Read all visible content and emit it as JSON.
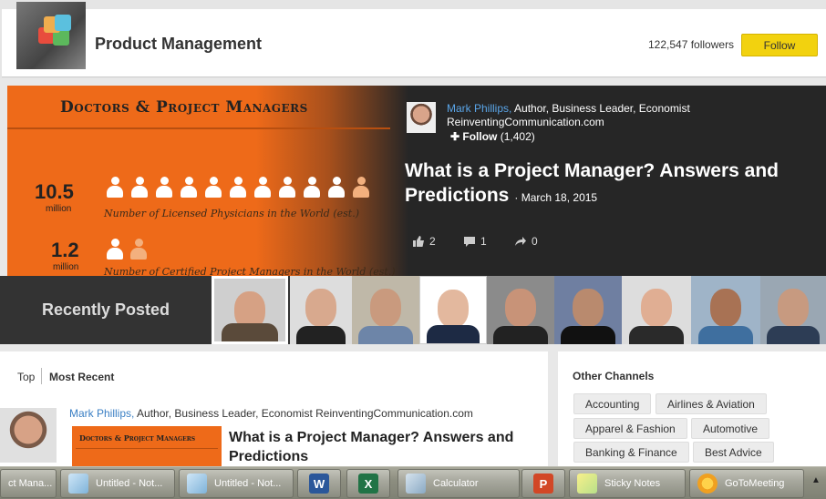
{
  "channel": {
    "title": "Product Management",
    "followers": "122,547 followers",
    "follow_label": "Follow"
  },
  "hero": {
    "infographic": {
      "title": "Doctors & Project Managers",
      "stat1_value": "10.5",
      "stat1_unit": "million",
      "stat1_desc": "Number of Licensed Physicians in the World (est.)",
      "stat2_value": "1.2",
      "stat2_unit": "million",
      "stat2_desc": "Number of Certified Project Managers in the World (est.)"
    },
    "author_name": "Mark Phillips,",
    "author_role": " Author, Business Leader, Economist",
    "author_site": "ReinventingCommunication.com",
    "follow_label": "✚ Follow",
    "follow_count": "(1,402)",
    "article_title": "What is a Project Manager? Answers and Predictions",
    "article_date": "· March 18, 2015",
    "likes": "2",
    "comments": "1",
    "shares": "0"
  },
  "recent": {
    "label": "Recently Posted"
  },
  "feed": {
    "tab_top": "Top",
    "tab_recent": "Most Recent",
    "author_name": "Mark Phillips,",
    "author_rest": " Author, Business Leader, Economist ReinventingCommunication.com",
    "thumb_title": "Doctors & Project Managers",
    "title": "What is a Project Manager? Answers and Predictions"
  },
  "channels": {
    "title": "Other Channels",
    "items": [
      "Accounting",
      "Airlines & Aviation",
      "Apparel & Fashion",
      "Automotive",
      "Banking & Finance",
      "Best Advice"
    ]
  },
  "taskbar": {
    "items": [
      {
        "label": "ct Mana...",
        "icon": "browser-icon"
      },
      {
        "label": "Untitled - Not...",
        "icon": "notepad-icon"
      },
      {
        "label": "Untitled - Not...",
        "icon": "notepad-icon"
      },
      {
        "label": "",
        "icon": "word-icon"
      },
      {
        "label": "",
        "icon": "excel-icon"
      },
      {
        "label": "Calculator",
        "icon": "calculator-icon"
      },
      {
        "label": "",
        "icon": "powerpoint-icon"
      },
      {
        "label": "Sticky Notes",
        "icon": "sticky-notes-icon"
      },
      {
        "label": "GoToMeeting",
        "icon": "gotomeeting-icon"
      }
    ],
    "tray_arrow": "▲"
  },
  "colors": {
    "accent_yellow": "#f2d20f",
    "infographic_orange": "#ee6a19",
    "link_blue": "#5aa5e8"
  }
}
